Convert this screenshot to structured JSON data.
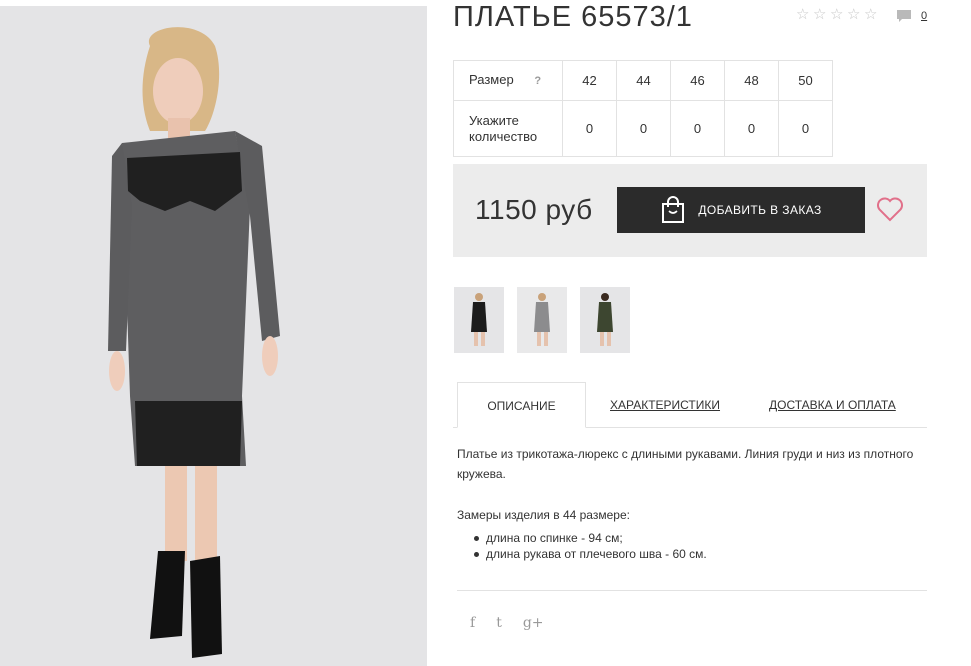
{
  "product": {
    "title": "ПЛАТЬЕ 65573/1",
    "rating_stars": 5,
    "rating_value": 0,
    "comments_count": "0"
  },
  "size_table": {
    "size_label": "Размер",
    "help_label": "?",
    "quantity_label": "Укажите количество",
    "sizes": [
      "42",
      "44",
      "46",
      "48",
      "50"
    ],
    "quantities": [
      "0",
      "0",
      "0",
      "0",
      "0"
    ]
  },
  "purchase": {
    "price": "1150 руб",
    "add_button_label": "ДОБАВИТЬ В ЗАКАЗ"
  },
  "tabs": [
    {
      "label": "ОПИСАНИЕ"
    },
    {
      "label": "ХАРАКТЕРИСТИКИ"
    },
    {
      "label": "ДОСТАВКА И ОПЛАТА"
    }
  ],
  "description": {
    "text": "Платье из трикотажа-люрекс с длиными рукавами. Линия груди и низ из плотного кружева.",
    "measures_title": "Замеры изделия в 44 размере:",
    "measures": [
      "длина по спинке - 94 см;",
      "длина рукава от плечевого шва - 60 см."
    ]
  },
  "social": {
    "facebook": "f",
    "twitter": "t",
    "googleplus": "g+"
  },
  "icons": {
    "star": "star-outline-icon",
    "comment": "speech-bubble-icon",
    "bag": "shopping-bag-icon",
    "favorite": "heart-icon"
  },
  "colors": {
    "accent_button": "#2b2b2b",
    "price_box": "#ececec",
    "heart": "#e1708a",
    "border": "#e2e2e2"
  }
}
